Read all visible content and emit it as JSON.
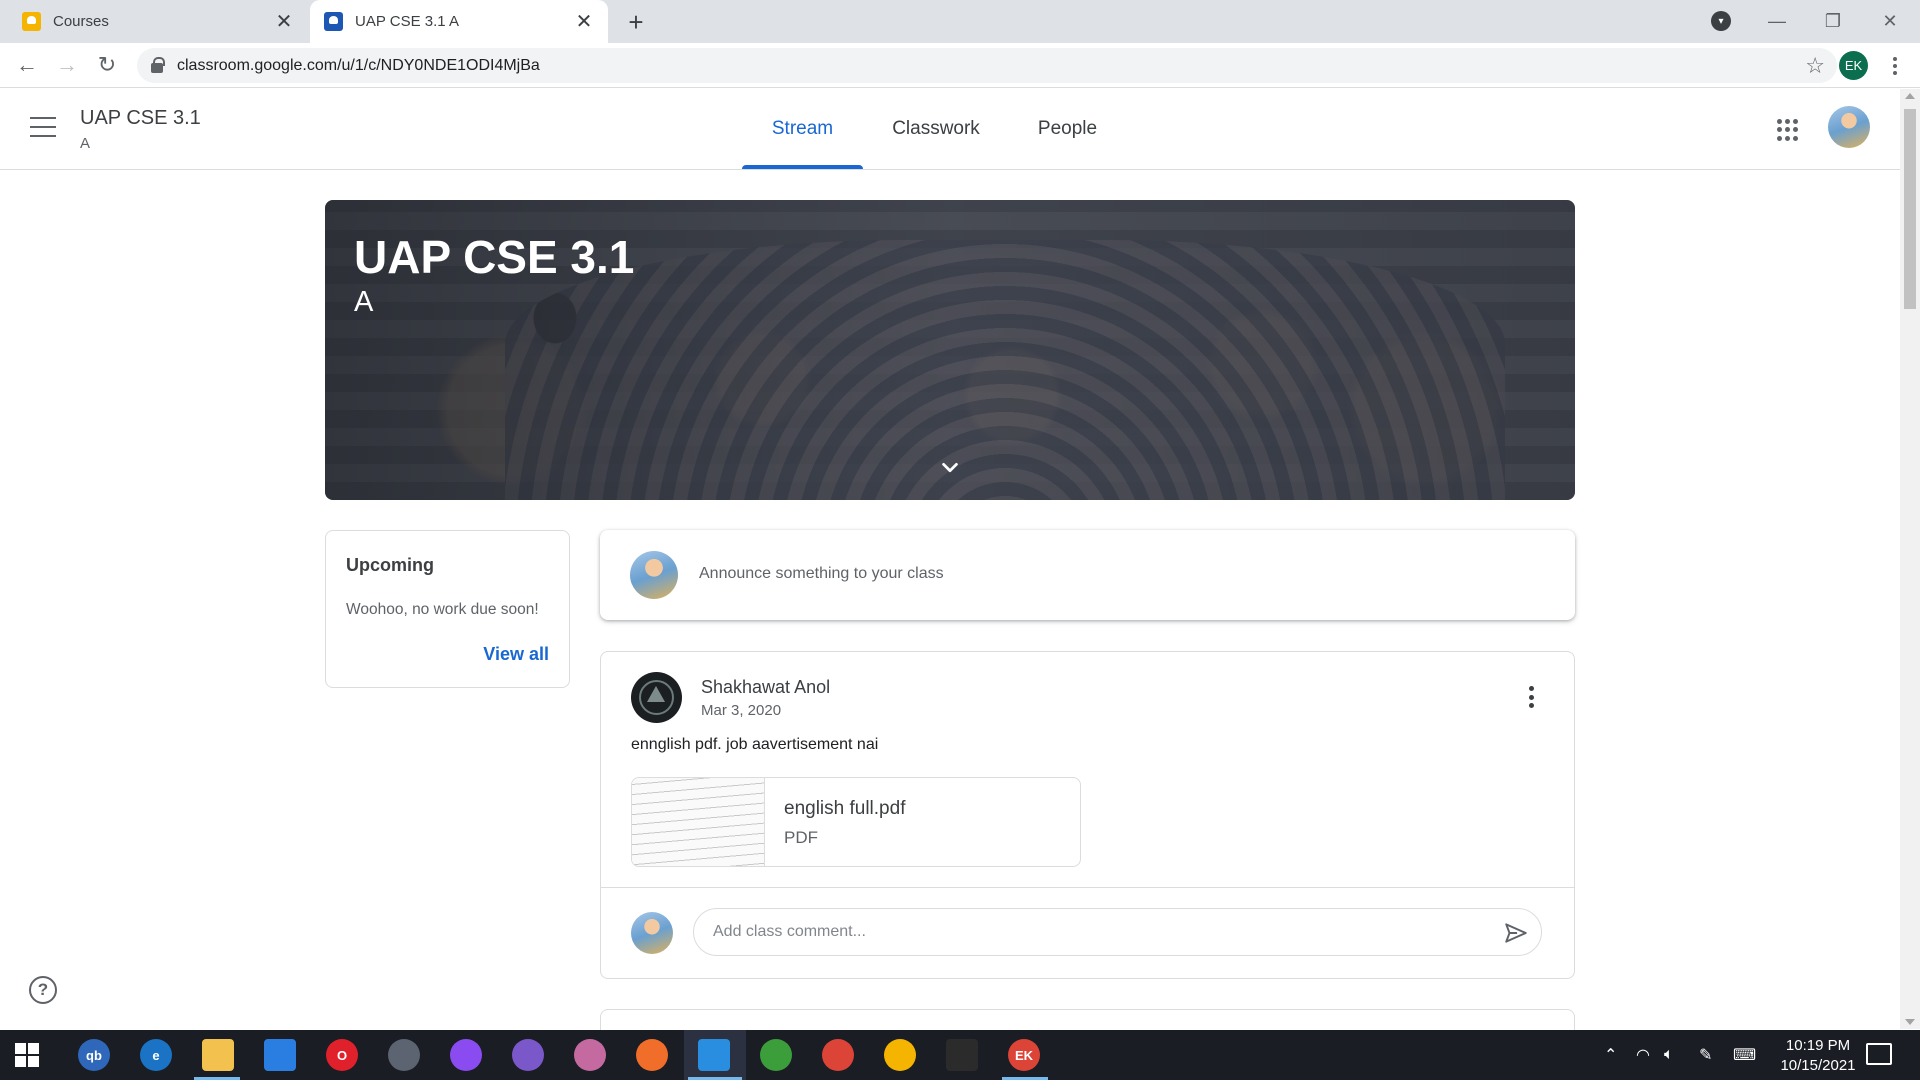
{
  "browser": {
    "tabs": [
      {
        "title": "Courses",
        "close": "✕"
      },
      {
        "title": "UAP CSE 3.1 A",
        "close": "✕"
      }
    ],
    "new_tab": "+",
    "url": "classroom.google.com/u/1/c/NDY0NDE1ODI4MjBa",
    "profile_initials": "EK"
  },
  "header": {
    "class_name": "UAP CSE 3.1",
    "section": "A",
    "tabs": [
      {
        "label": "Stream",
        "active": true
      },
      {
        "label": "Classwork",
        "active": false
      },
      {
        "label": "People",
        "active": false
      }
    ]
  },
  "banner": {
    "title": "UAP CSE 3.1",
    "section": "A"
  },
  "upcoming": {
    "title": "Upcoming",
    "message": "Woohoo, no work due soon!",
    "view_all": "View all"
  },
  "announce": {
    "placeholder": "Announce something to your class"
  },
  "post": {
    "author": "Shakhawat Anol",
    "date": "Mar 3, 2020",
    "body": "ennglish pdf. job aavertisement nai",
    "attachment": {
      "name": "english full.pdf",
      "type": "PDF"
    },
    "comment_placeholder": "Add class comment..."
  },
  "taskbar": {
    "time": "10:19 PM",
    "date": "10/15/2021",
    "pinned": [
      {
        "name": "qbittorrent-icon",
        "label": "qb",
        "color": "#2f67ba"
      },
      {
        "name": "edge-icon",
        "label": "e",
        "color": "#1a73c4"
      },
      {
        "name": "file-explorer-icon",
        "label": "",
        "color": "#f2c14e"
      },
      {
        "name": "mail-icon",
        "label": "",
        "color": "#2a7de1"
      },
      {
        "name": "opera-icon",
        "label": "O",
        "color": "#e0202b"
      },
      {
        "name": "inkscape-icon",
        "label": "",
        "color": "#5b6470"
      },
      {
        "name": "messenger-icon",
        "label": "",
        "color": "#8a4cf0"
      },
      {
        "name": "github-icon",
        "label": "",
        "color": "#7b58c9"
      },
      {
        "name": "network-app-icon",
        "label": "",
        "color": "#c46aa0"
      },
      {
        "name": "firefox-icon",
        "label": "",
        "color": "#f06d2a"
      },
      {
        "name": "vscode-icon",
        "label": "",
        "color": "#2a8ee0"
      },
      {
        "name": "anaconda-icon",
        "label": "",
        "color": "#3b9e3b"
      },
      {
        "name": "chrome-icon",
        "label": "",
        "color": "#db4437"
      },
      {
        "name": "chrome-alt-icon",
        "label": "",
        "color": "#f4b400"
      },
      {
        "name": "terminal-icon",
        "label": "",
        "color": "#2b2b2b"
      },
      {
        "name": "chrome-profile-icon",
        "label": "EK",
        "color": "#db4437"
      }
    ]
  },
  "colors": {
    "accent": "#1967d2",
    "taskbar": "#1a1d24"
  }
}
